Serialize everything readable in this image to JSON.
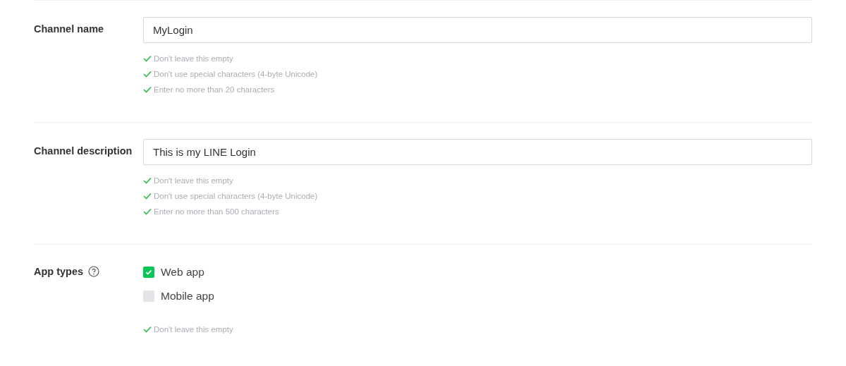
{
  "sections": [
    {
      "kind": "text",
      "label": "Channel name",
      "value": "MyLogin",
      "rules": [
        {
          "text": "Don't leave this empty",
          "met": true
        },
        {
          "text": "Don't use special characters (4-byte Unicode)",
          "met": true
        },
        {
          "text": "Enter no more than 20 characters",
          "met": true
        }
      ]
    },
    {
      "kind": "text",
      "label": "Channel description",
      "value": "This is my LINE Login",
      "rules": [
        {
          "text": "Don't leave this empty",
          "met": true
        },
        {
          "text": "Don't use special characters (4-byte Unicode)",
          "met": true
        },
        {
          "text": "Enter no more than 500 characters",
          "met": true
        }
      ]
    },
    {
      "kind": "checkboxes",
      "label": "App types",
      "help": true,
      "options": [
        {
          "label": "Web app",
          "checked": true
        },
        {
          "label": "Mobile app",
          "checked": false
        }
      ],
      "rules": [
        {
          "text": "Don't leave this empty",
          "met": true
        }
      ]
    }
  ]
}
